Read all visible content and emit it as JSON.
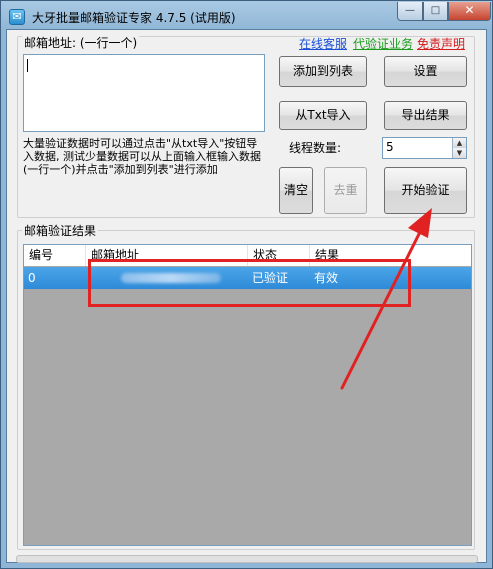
{
  "window": {
    "title": "大牙批量邮箱验证专家 4.7.5 (试用版)",
    "app_icon_glyph": "✉",
    "controls": {
      "minimize": "—",
      "maximize": "□",
      "close": "✕"
    }
  },
  "input_panel": {
    "label": "邮箱地址: (一行一个)",
    "textarea_value": "",
    "hint": "大量验证数据时可以通过点击\"从txt导入\"按钮导入数据, 测试少量数据可以从上面输入框输入数据(一行一个)并点击\"添加到列表\"进行添加"
  },
  "links": {
    "online_support": "在线客服",
    "verification_service": "代验证业务",
    "disclaimer": "免责声明",
    "colors": {
      "online_support": "#1a4fd6",
      "verification_service": "#1b9b1b",
      "disclaimer": "#d41b1b"
    }
  },
  "buttons": {
    "add_to_list": "添加到列表",
    "settings": "设置",
    "import_txt": "从Txt导入",
    "export_results": "导出结果",
    "clear": "清空",
    "dedupe": "去重",
    "start_verify": "开始验证"
  },
  "thread_count": {
    "label": "线程数量:",
    "value": "5"
  },
  "results": {
    "label": "邮箱验证结果",
    "columns": [
      "编号",
      "邮箱地址",
      "状态",
      "结果"
    ],
    "rows": [
      {
        "id": "0",
        "email": "",
        "status": "已验证",
        "result": "有效"
      }
    ]
  },
  "annotation": {
    "highlight_color": "#e02222"
  }
}
